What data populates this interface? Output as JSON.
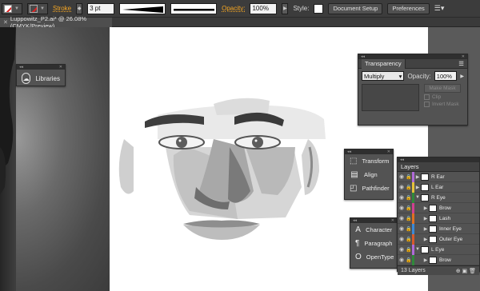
{
  "control_bar": {
    "stroke_label": "Stroke",
    "stroke_weight": "3 pt",
    "opacity_label": "Opacity:",
    "opacity_value": "100%",
    "style_label": "Style:",
    "document_setup": "Document Setup",
    "preferences": "Preferences"
  },
  "document": {
    "tab_title": "Luppowitz_P2.ai* @ 26.08% (CMYK/Preview)"
  },
  "libraries_panel": {
    "label": "Libraries"
  },
  "transparency_panel": {
    "title": "Transparency",
    "blend_mode": "Multiply",
    "opacity_label": "Opacity:",
    "opacity_value": "100%",
    "make_mask": "Make Mask",
    "clip": "Clip",
    "invert_mask": "Invert Mask"
  },
  "transform_panel": {
    "items": [
      {
        "label": "Transform",
        "icon": "transform-icon"
      },
      {
        "label": "Align",
        "icon": "align-icon"
      },
      {
        "label": "Pathfinder",
        "icon": "pathfinder-icon"
      }
    ]
  },
  "type_panel": {
    "items": [
      {
        "label": "Character",
        "icon": "character-icon"
      },
      {
        "label": "Paragraph",
        "icon": "paragraph-icon"
      },
      {
        "label": "OpenType",
        "icon": "opentype-icon"
      }
    ]
  },
  "layers_panel": {
    "title": "Layers",
    "rows": [
      {
        "name": "R Ear",
        "color": "#b06ad8",
        "expanded": false
      },
      {
        "name": "L Ear",
        "color": "#e6c23a",
        "expanded": false
      },
      {
        "name": "R Eye",
        "color": "#2f8a3a",
        "expanded": true
      },
      {
        "name": "Brow",
        "color": "#d04090",
        "expanded": false
      },
      {
        "name": "Lash",
        "color": "#e07020",
        "expanded": false
      },
      {
        "name": "Inner Eye",
        "color": "#3a8ad8",
        "expanded": false
      },
      {
        "name": "Outer Eye",
        "color": "#d85a2a",
        "expanded": false
      },
      {
        "name": "L Eye",
        "color": "#b06ad8",
        "expanded": true
      },
      {
        "name": "Brow",
        "color": "#2f8a3a",
        "expanded": false
      }
    ],
    "footer": "13 Layers"
  }
}
